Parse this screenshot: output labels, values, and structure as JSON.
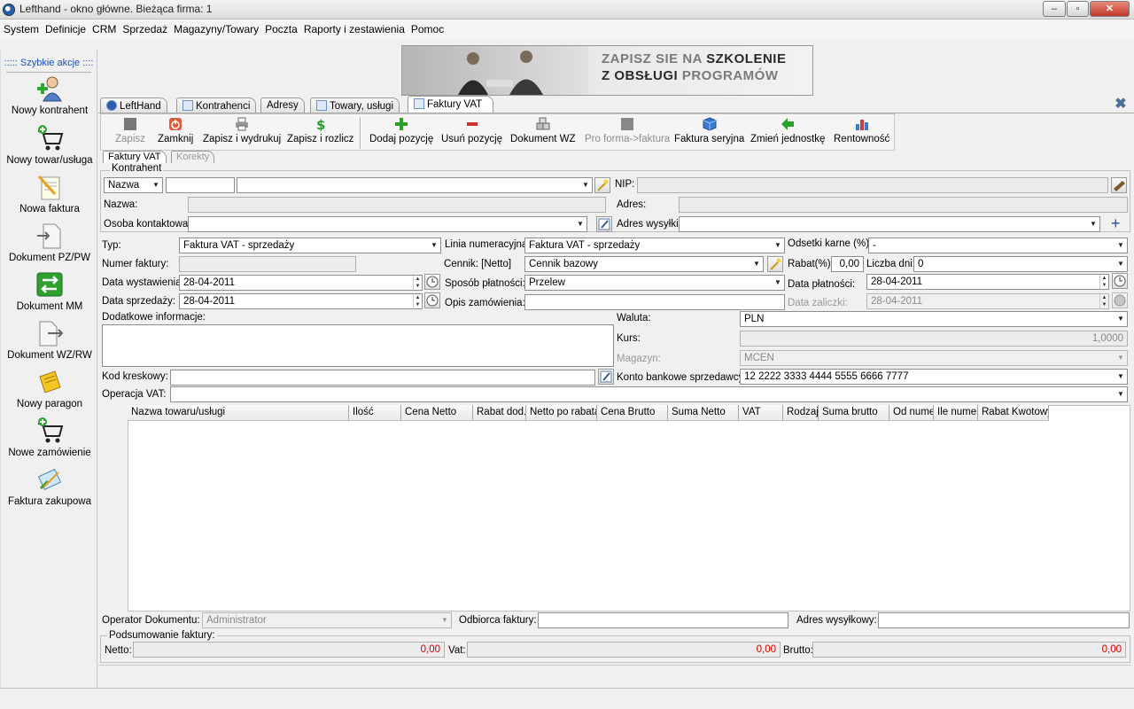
{
  "window": {
    "title": "Lefthand - okno główne. Bieżąca firma: 1",
    "minimize": "–",
    "maximize": "▫",
    "close": "✕"
  },
  "menu": [
    "System",
    "Definicje",
    "CRM",
    "Sprzedaż",
    "Magazyny/Towary",
    "Poczta",
    "Raporty i zestawienia",
    "Pomoc"
  ],
  "sidebar": {
    "header": "::::: Szybkie akcje ::::",
    "items": [
      {
        "label": "Nowy kontrahent",
        "icon": "user-add-icon"
      },
      {
        "label": "Nowy towar/usługa",
        "icon": "cart-add-icon"
      },
      {
        "label": "Nowa faktura",
        "icon": "invoice-icon"
      },
      {
        "label": "Dokument PZ/PW",
        "icon": "document-in-icon"
      },
      {
        "label": "Dokument MM",
        "icon": "transfer-icon"
      },
      {
        "label": "Dokument WZ/RW",
        "icon": "document-out-icon"
      },
      {
        "label": "Nowy paragon",
        "icon": "receipt-icon"
      },
      {
        "label": "Nowe zamówienie",
        "icon": "order-cart-icon"
      },
      {
        "label": "Faktura zakupowa",
        "icon": "purchase-invoice-icon"
      }
    ]
  },
  "banner": {
    "line1_a": "ZAPISZ SIE NA ",
    "line1_b": "SZKOLENIE",
    "line2_a": "Z OBSŁUGI ",
    "line2_b": "PROGRAMÓW"
  },
  "tabs": [
    "LeftHand",
    "Kontrahenci",
    "Adresy",
    "Towary, usługi",
    "Faktury VAT"
  ],
  "toolbar": {
    "save": "Zapisz",
    "close": "Zamknij",
    "save_print": "Zapisz i wydrukuj",
    "save_settle": "Zapisz i rozlicz",
    "add_pos": "Dodaj pozycję",
    "remove_pos": "Usuń pozycję",
    "wz": "Dokument WZ",
    "proforma": "Pro forma->faktura",
    "serial": "Faktura seryjna",
    "unit": "Zmień jednostkę",
    "profit": "Rentowność"
  },
  "subtabs": [
    "Faktury VAT",
    "Korekty"
  ],
  "kontrahent": {
    "group": "Kontrahent",
    "search_by": "Nazwa",
    "nip_label": "NIP:",
    "name_label": "Nazwa:",
    "address_label": "Adres:",
    "contact_label": "Osoba kontaktowa:",
    "ship_label": "Adres wysyłki:",
    "plus": "+"
  },
  "form": {
    "typ_label": "Typ:",
    "typ": "Faktura VAT - sprzedaży",
    "linia_label": "Linia numeracyjna:",
    "linia": "Faktura VAT - sprzedaży",
    "odsetki_label": "Odsetki karne (%):",
    "odsetki": "-",
    "numer_label": "Numer faktury:",
    "cennik_label": "Cennik: [Netto]",
    "cennik": "Cennik bazowy",
    "rabat_label": "Rabat(%):",
    "rabat": "0,00",
    "liczba_dni_label": "Liczba dni:",
    "liczba_dni": "0",
    "data_wyst_label": "Data wystawienia:",
    "data_wyst": "28-04-2011",
    "sposob_label": "Sposób płatności:",
    "sposob": "Przelew",
    "data_platn_label": "Data płatności:",
    "data_platn": "28-04-2011",
    "data_sprz_label": "Data sprzedaży:",
    "data_sprz": "28-04-2011",
    "opis_label": "Opis zamówienia:",
    "data_zal_label": "Data zaliczki:",
    "data_zal": "28-04-2011",
    "dodatkowe_label": "Dodatkowe informacje:",
    "waluta_label": "Waluta:",
    "waluta": "PLN",
    "kurs_label": "Kurs:",
    "kurs": "1,0000",
    "magazyn_label": "Magazyn:",
    "magazyn": "MCEN",
    "kod_label": "Kod kreskowy:",
    "konto_label": "Konto bankowe sprzedawcy:",
    "konto": "12 2222 3333 4444 5555 6666 7777",
    "operacja_label": "Operacja VAT:"
  },
  "grid_columns": [
    "Nazwa towaru/usługi",
    "Ilość",
    "Cena Netto",
    "Rabat dod.",
    "Netto po rabata",
    "Cena Brutto",
    "Suma Netto",
    "VAT",
    "Rodzaj",
    "Suma brutto",
    "Od nume",
    "Ile numer",
    "Rabat Kwotowy"
  ],
  "footer": {
    "operator_label": "Operator Dokumentu:",
    "operator": "Administrator",
    "odbiorca_label": "Odbiorca faktury:",
    "adres_wys_label": "Adres wysyłkowy:",
    "summary_group": "Podsumowanie faktury:",
    "netto_label": "Netto:",
    "netto": "0,00",
    "vat_label": "Vat:",
    "vat": "0,00",
    "brutto_label": "Brutto:",
    "brutto": "0,00"
  },
  "colors": {
    "accent_blue": "#1f4fb0",
    "amount_red": "#d00000"
  }
}
